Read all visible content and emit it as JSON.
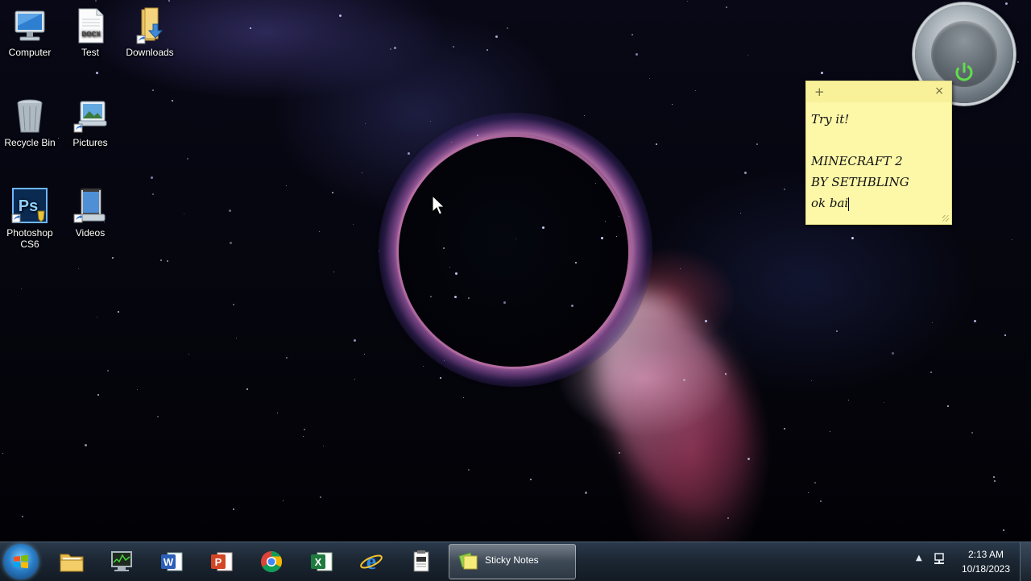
{
  "desktop": {
    "icons": [
      {
        "label": "Computer",
        "icon": "computer-icon"
      },
      {
        "label": "Test",
        "icon": "docx-file-icon",
        "badge": "DOCX"
      },
      {
        "label": "Downloads",
        "icon": "downloads-folder-icon"
      },
      {
        "label": "Recycle Bin",
        "icon": "recycle-bin-icon"
      },
      {
        "label": "Pictures",
        "icon": "pictures-shortcut-icon"
      },
      {
        "label": "Photoshop CS6",
        "icon": "photoshop-icon",
        "badge": "Ps"
      },
      {
        "label": "Videos",
        "icon": "videos-shortcut-icon"
      }
    ]
  },
  "sticky_note": {
    "add_glyph": "+",
    "close_glyph": "×",
    "lines": [
      "Try it!",
      "",
      "MINECRAFT 2",
      "BY SETHBLING",
      "ok bai"
    ]
  },
  "gadget": {
    "icon": "power-icon",
    "accent": "#5fe04a"
  },
  "taskbar": {
    "start_icon": "windows-start-icon",
    "pinned": [
      {
        "name": "windows-explorer",
        "icon": "folder-icon"
      },
      {
        "name": "task-manager",
        "icon": "monitor-icon"
      },
      {
        "name": "word",
        "icon": "word-icon",
        "badge": "W"
      },
      {
        "name": "powerpoint",
        "icon": "powerpoint-icon",
        "badge": "P"
      },
      {
        "name": "chrome",
        "icon": "chrome-icon"
      },
      {
        "name": "excel",
        "icon": "excel-icon",
        "badge": "X"
      },
      {
        "name": "internet-explorer",
        "icon": "ie-icon",
        "badge": "e"
      },
      {
        "name": "clipboard-app",
        "icon": "notepad-icon"
      }
    ],
    "active_task": {
      "label": "Sticky Notes",
      "icon": "sticky-notes-icon"
    },
    "tray": {
      "arrow": "▲",
      "time": "2:13 AM",
      "date": "10/18/2023"
    }
  }
}
